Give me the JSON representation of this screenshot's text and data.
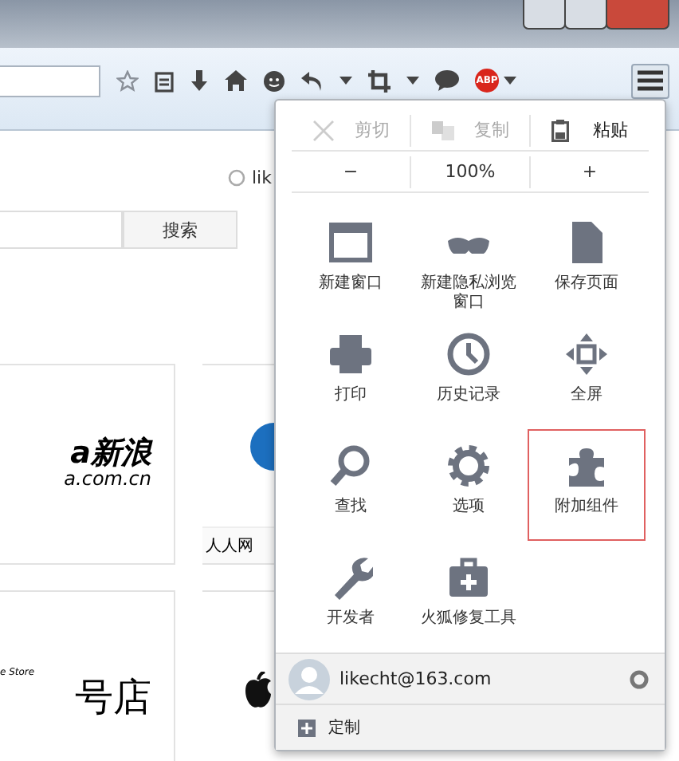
{
  "toolbar": {
    "abp_label": "ABP"
  },
  "page": {
    "sync_link": "lik",
    "search_button": "搜索",
    "tiles": [
      {
        "kind": "text_logo",
        "logo_main": "a新浪",
        "logo_sub": "a.com.cn"
      },
      {
        "kind": "blue_logo",
        "caption": "人人网"
      },
      {
        "kind": "store_logo",
        "logo_main": "号店",
        "logo_sub": "e Store"
      },
      {
        "kind": "apple_logo"
      }
    ]
  },
  "menu": {
    "edit_actions": [
      {
        "label": "剪切",
        "disabled": true
      },
      {
        "label": "复制",
        "disabled": true
      },
      {
        "label": "粘贴",
        "disabled": false
      }
    ],
    "zoom": {
      "out": "−",
      "value": "100%",
      "in": "+"
    },
    "items": [
      {
        "label": "新建窗口",
        "highlighted": false
      },
      {
        "label": "新建隐私浏览窗口",
        "highlighted": false
      },
      {
        "label": "保存页面",
        "highlighted": false
      },
      {
        "label": "打印",
        "highlighted": false
      },
      {
        "label": "历史记录",
        "highlighted": false
      },
      {
        "label": "全屏",
        "highlighted": false
      },
      {
        "label": "查找",
        "highlighted": false
      },
      {
        "label": "选项",
        "highlighted": false
      },
      {
        "label": "附加组件",
        "highlighted": true
      },
      {
        "label": "开发者",
        "highlighted": false
      },
      {
        "label": "火狐修复工具",
        "highlighted": false
      }
    ],
    "account": "likecht@163.com",
    "customize": "定制"
  }
}
